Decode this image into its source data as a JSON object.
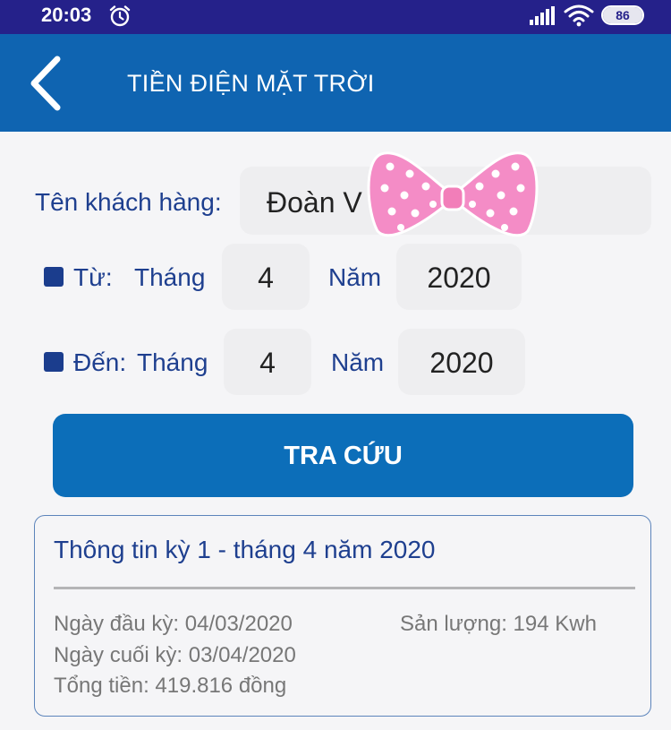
{
  "status_bar": {
    "time": "20:03",
    "battery": "86"
  },
  "app_bar": {
    "title": "TIỀN ĐIỆN MẶT TRỜI"
  },
  "form": {
    "customer_label": "Tên khách hàng:",
    "customer_value": "Đoàn V",
    "from_label": "Từ:",
    "to_label": "Đến:",
    "month_label": "Tháng",
    "year_label": "Năm",
    "from_month": "4",
    "from_year": "2020",
    "to_month": "4",
    "to_year": "2020",
    "search_button": "TRA CỨU"
  },
  "info_card": {
    "title": "Thông tin kỳ 1 - tháng 4 năm 2020",
    "start_date": "Ngày đầu kỳ: 04/03/2020",
    "end_date": "Ngày cuối kỳ: 03/04/2020",
    "total": "Tổng tiền: 419.816 đồng",
    "output": "Sản lượng: 194 Kwh"
  },
  "colors": {
    "status_bar": "#25218a",
    "app_bar": "#0f64b1",
    "button": "#0c6eb9",
    "label": "#1e3f8f",
    "sticker_pink": "#f48cc6"
  },
  "icons": [
    "alarm-clock-icon",
    "signal-icon",
    "wifi-icon",
    "battery-icon",
    "back-arrow-icon",
    "bow-sticker"
  ]
}
